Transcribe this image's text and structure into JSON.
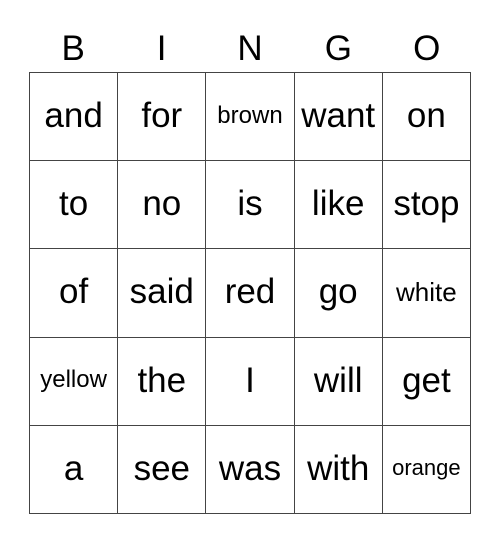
{
  "header": [
    "B",
    "I",
    "N",
    "G",
    "O"
  ],
  "board": [
    [
      "and",
      "for",
      "brown",
      "want",
      "on"
    ],
    [
      "to",
      "no",
      "is",
      "like",
      "stop"
    ],
    [
      "of",
      "said",
      "red",
      "go",
      "white"
    ],
    [
      "yellow",
      "the",
      "I",
      "will",
      "get"
    ],
    [
      "a",
      "see",
      "was",
      "with",
      "orange"
    ]
  ]
}
